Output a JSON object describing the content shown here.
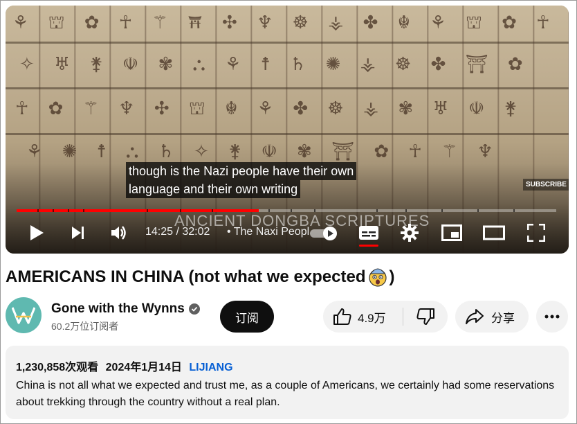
{
  "video": {
    "captions": [
      "though is the Nazi people have their own",
      "language and their own writing"
    ],
    "watermark": "SUBSCRIBE",
    "overlay_title": "ANCIENT DONGBA SCRIPTURES",
    "progress": 0.449,
    "time": "14:25 / 32:02",
    "chapter": "• The Naxi Peopl"
  },
  "controls": {
    "play_icon": "play-icon",
    "next_icon": "next-icon",
    "volume_icon": "volume-icon",
    "autoplay_icon": "autoplay-toggle-icon",
    "cc_icon": "subtitles-icon",
    "settings_icon": "gear-icon",
    "miniplayer_icon": "miniplayer-icon",
    "theater_icon": "theater-icon",
    "fullscreen_icon": "fullscreen-icon"
  },
  "title": {
    "text_before": "AMERICANS IN CHINA (not what we expected",
    "emoji": "shocked-face-emoji",
    "text_after": ")"
  },
  "channel": {
    "name": "Gone with the Wynns",
    "subscribers": "60.2万位订阅者",
    "subscribe_label": "订阅"
  },
  "actions": {
    "likes": "4.9万",
    "share_label": "分享",
    "more_icon": "more-icon"
  },
  "description": {
    "views": "1,230,858次观看",
    "date": "2024年1月14日",
    "tag": "LIJIANG",
    "text": "China is not all what we expected and trust me, as a couple of Americans, we certainly had some reservations about trekking through the country without a real plan."
  },
  "colors": {
    "progress": "#ff0000",
    "subscribe_bg": "#0f0f0f",
    "link": "#065fd4",
    "avatar": "#5fb9b0"
  }
}
